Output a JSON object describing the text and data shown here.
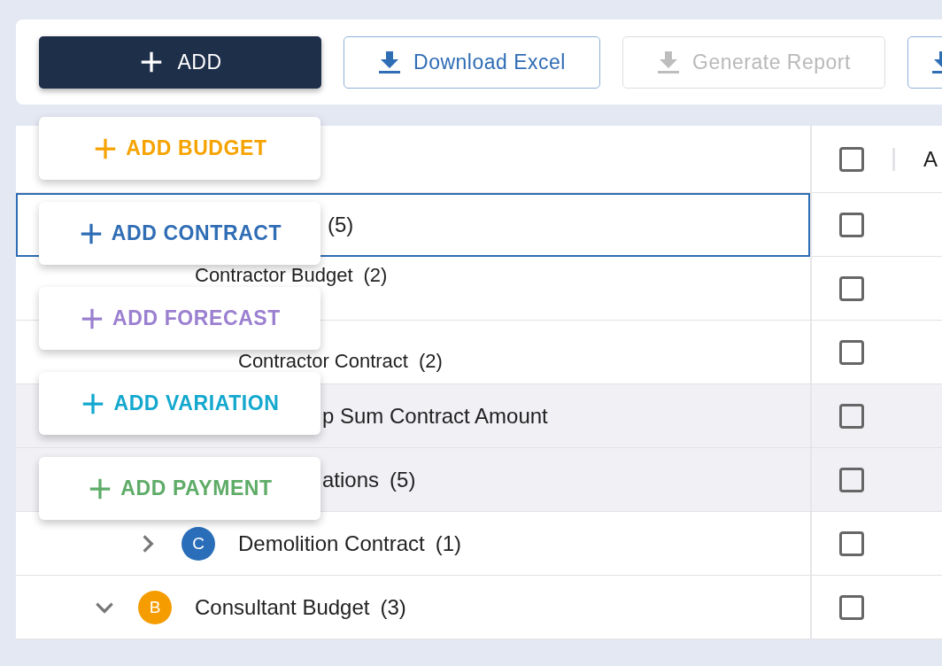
{
  "toolbar": {
    "buttons": [
      {
        "kind": "primary",
        "label": "ADD"
      },
      {
        "kind": "outlined",
        "label": "Download Excel"
      },
      {
        "kind": "disabled",
        "label": "Generate Report"
      },
      {
        "kind": "outlined"
      }
    ]
  },
  "add_menu": [
    {
      "label": "ADD BUDGET",
      "color": "#f5a300"
    },
    {
      "label": "ADD CONTRACT",
      "color": "#2f6db5"
    },
    {
      "label": "ADD FORECAST",
      "color": "#9b80d0"
    },
    {
      "label": "ADD VARIATION",
      "color": "#14a8cf"
    },
    {
      "label": "ADD PAYMENT",
      "color": "#5fac68"
    }
  ],
  "table": {
    "columns": [
      {
        "label": "A",
        "checked": false
      }
    ],
    "rows": [
      {
        "kind": "partial",
        "count": "(5)",
        "selected": true,
        "checked": false,
        "children": [
          {
            "kind": "upper",
            "label": "Contractor Budget",
            "count": "(2)",
            "selected": false,
            "checked": false,
            "children": [
              {
                "kind": "lower",
                "label": "Contractor Contract",
                "count": "(2)",
                "selected": false,
                "checked": false,
                "children": [
                  {
                    "kind": "partial",
                    "label": "p Sum Contract Amount",
                    "selected": false,
                    "checked": false,
                    "shaded": true
                  },
                  {
                    "kind": "partial",
                    "label": "ations",
                    "count": "(5)",
                    "selected": false,
                    "checked": false,
                    "shaded": true
                  }
                ]
              },
              {
                "kind": "node",
                "avatar": "C",
                "color": "#2a6db8",
                "label": "Demolition Contract",
                "count": "(1)",
                "selected": false,
                "checked": false,
                "expanded": false
              }
            ]
          },
          {
            "kind": "node",
            "avatar": "B",
            "color": "#f59c00",
            "label": "Consultant Budget",
            "count": "(3)",
            "selected": false,
            "checked": false,
            "expanded": true
          }
        ]
      }
    ]
  }
}
